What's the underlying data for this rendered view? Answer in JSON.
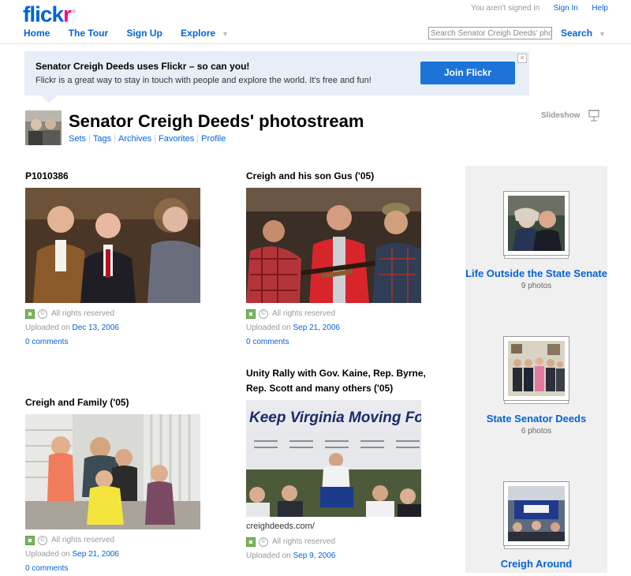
{
  "header": {
    "logo_main": "flick",
    "logo_accent": "r",
    "not_signed_in": "You aren't signed in",
    "sign_in": "Sign In",
    "help": "Help"
  },
  "nav": {
    "home": "Home",
    "tour": "The Tour",
    "signup": "Sign Up",
    "explore": "Explore",
    "search_placeholder": "Search Senator Creigh Deeds' photostream",
    "search_button": "Search"
  },
  "promo": {
    "title": "Senator Creigh Deeds uses Flickr – so can you!",
    "text": "Flickr is a great way to stay in touch with people and explore the world. It's free and fun!",
    "join": "Join Flickr",
    "close": "×"
  },
  "profile": {
    "title": "Senator Creigh Deeds' photostream",
    "links": [
      "Sets",
      "Tags",
      "Archives",
      "Favorites",
      "Profile"
    ],
    "slideshow": "Slideshow"
  },
  "photos": [
    {
      "title": "P1010386",
      "rights": "All rights reserved",
      "uploaded_prefix": "Uploaded on",
      "date": "Dec 13, 2006",
      "comments": "0 comments"
    },
    {
      "title": "Creigh and his son Gus ('05)",
      "rights": "All rights reserved",
      "uploaded_prefix": "Uploaded on",
      "date": "Sep 21, 2006",
      "comments": "0 comments"
    },
    {
      "title": "Creigh and Family ('05)",
      "rights": "All rights reserved",
      "uploaded_prefix": "Uploaded on",
      "date": "Sep 21, 2006",
      "comments": "0 comments"
    },
    {
      "title": "Unity Rally with Gov. Kaine, Rep. Byrne, Rep. Scott and many others ('05)",
      "caption": "creighdeeds.com/",
      "rights": "All rights reserved",
      "uploaded_prefix": "Uploaded on",
      "date": "Sep 9, 2006",
      "banner": "Keep Virginia Moving Forward"
    }
  ],
  "sets": [
    {
      "title": "Life Outside the State Senate",
      "count": "9 photos"
    },
    {
      "title": "State Senator Deeds",
      "count": "6 photos"
    },
    {
      "title": "Creigh Around"
    }
  ],
  "colors": {
    "link": "#0063dc",
    "pink": "#ff0084",
    "promo_bg": "#e7eef7",
    "join_btn": "#1d73d8"
  }
}
